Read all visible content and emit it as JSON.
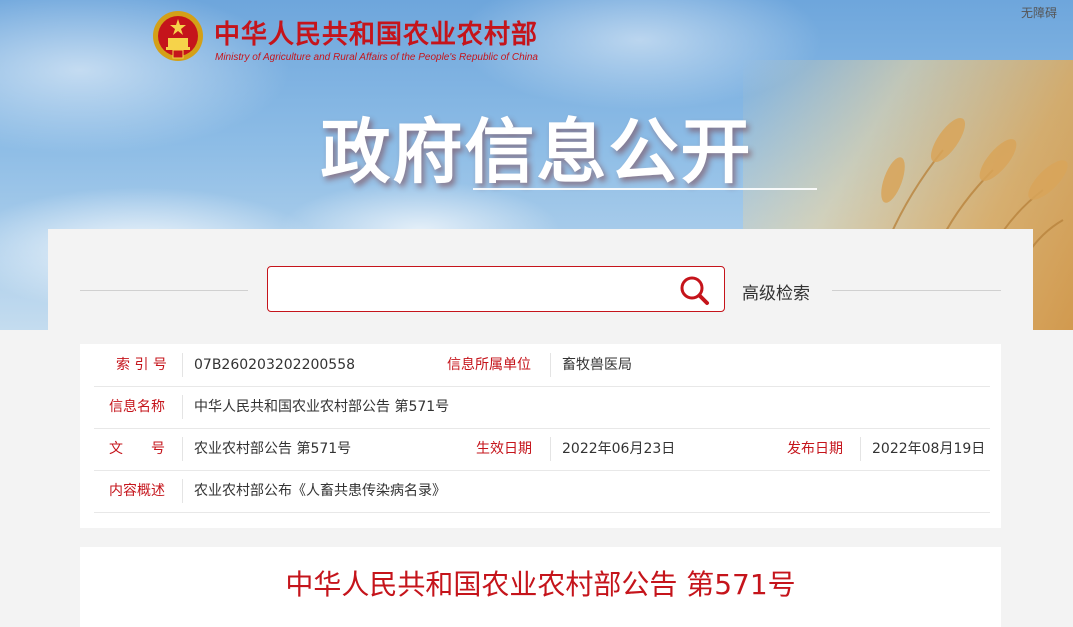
{
  "header": {
    "site_title": "中华人民共和国农业农村部",
    "site_subtitle": "Ministry of Agriculture and Rural Affairs of the People's Republic of China",
    "accessibility_link": "无障碍",
    "hero_title": "政府信息公开",
    "emblem_icon": "national-emblem-icon"
  },
  "search": {
    "placeholder": "",
    "value": "",
    "advanced_label": "高级检索",
    "icon": "search-icon"
  },
  "info": {
    "index_label": "索 引 号",
    "index_value": "07B260203202200558",
    "unit_label": "信息所属单位",
    "unit_value": "畜牧兽医局",
    "name_label": "信息名称",
    "name_value": "中华人民共和国农业农村部公告 第571号",
    "doc_label": "文　　号",
    "doc_value": "农业农村部公告 第571号",
    "effective_label": "生效日期",
    "effective_value": "2022年06月23日",
    "publish_label": "发布日期",
    "publish_value": "2022年08月19日",
    "summary_label": "内容概述",
    "summary_value": "农业农村部公布《人畜共患传染病名录》"
  },
  "article": {
    "title": "中华人民共和国农业农村部公告 第571号"
  },
  "colors": {
    "brand_red": "#c5141b",
    "sky_blue": "#8ebde6",
    "background": "#f3f3f3"
  }
}
